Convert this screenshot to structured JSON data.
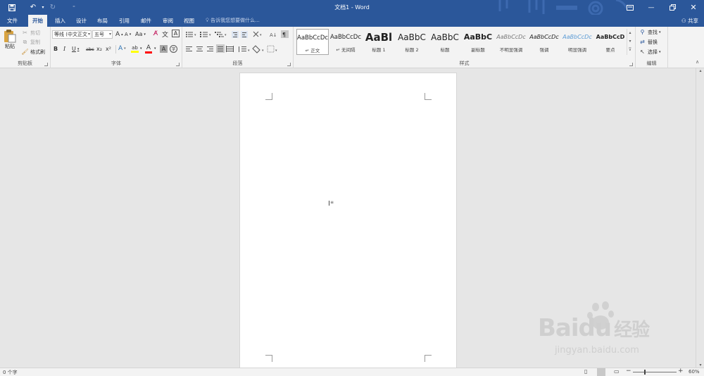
{
  "title_bar": {
    "title": "文档1 - Word",
    "quick_access": {
      "save_icon": "save-icon",
      "undo_icon": "undo-icon",
      "redo_icon": "redo-icon",
      "customize_icon": "customize-qat-icon"
    },
    "window_buttons": {
      "ribbon_display_icon": "ribbon-display-options-icon",
      "minimize_icon": "minimize-icon",
      "restore_icon": "restore-icon",
      "close_icon": "close-icon"
    }
  },
  "tabs": [
    {
      "label": "文件"
    },
    {
      "label": "开始",
      "active": true
    },
    {
      "label": "插入"
    },
    {
      "label": "设计"
    },
    {
      "label": "布局"
    },
    {
      "label": "引用"
    },
    {
      "label": "邮件"
    },
    {
      "label": "审阅"
    },
    {
      "label": "视图"
    }
  ],
  "tell_me": {
    "placeholder": "告诉我您想要做什么..."
  },
  "share": {
    "label": "共享"
  },
  "ribbon": {
    "clipboard": {
      "label": "剪贴板",
      "paste": "粘贴",
      "cut": "剪切",
      "copy": "复制",
      "format_painter": "格式刷"
    },
    "font": {
      "label": "字体",
      "font_name": "等线 (中文正文",
      "font_size": "五号",
      "grow": "A",
      "shrink": "A",
      "change_case": "Aa",
      "bold": "B",
      "italic": "I",
      "underline": "U",
      "strikethrough": "abc",
      "subscript": "x₂",
      "superscript": "x²",
      "text_effects": "A",
      "highlight": "ab",
      "font_color": "A",
      "char_shading": "A",
      "enclose": "字"
    },
    "paragraph": {
      "label": "段落"
    },
    "styles": {
      "label": "样式",
      "items": [
        {
          "preview": "AaBbCcDc",
          "name": "↵ 正文",
          "selected": true
        },
        {
          "preview": "AaBbCcDc",
          "name": "↵ 无间隔"
        },
        {
          "preview": "AaBl",
          "name": "标题 1"
        },
        {
          "preview": "AaBbC",
          "name": "标题 2"
        },
        {
          "preview": "AaBbC",
          "name": "标题"
        },
        {
          "preview": "AaBbC",
          "name": "副标题"
        },
        {
          "preview": "AaBbCcDc",
          "name": "不明显强调"
        },
        {
          "preview": "AaBbCcDc",
          "name": "强调"
        },
        {
          "preview": "AaBbCcDc",
          "name": "明显强调"
        },
        {
          "preview": "AaBbCcD",
          "name": "要点"
        }
      ]
    },
    "editing": {
      "label": "编辑",
      "find": "查找",
      "replace": "替换",
      "select": "选择"
    }
  },
  "status_bar": {
    "word_count": "0 个字",
    "zoom": "60%"
  },
  "watermark": {
    "brand": "Baidu",
    "brand_cn": "经验",
    "url": "jingyan.baidu.com"
  },
  "colors": {
    "word_blue": "#2b579a",
    "highlight_yellow": "#ffff00",
    "font_red": "#ff0000",
    "ribbon_bg": "#f3f3f3"
  }
}
